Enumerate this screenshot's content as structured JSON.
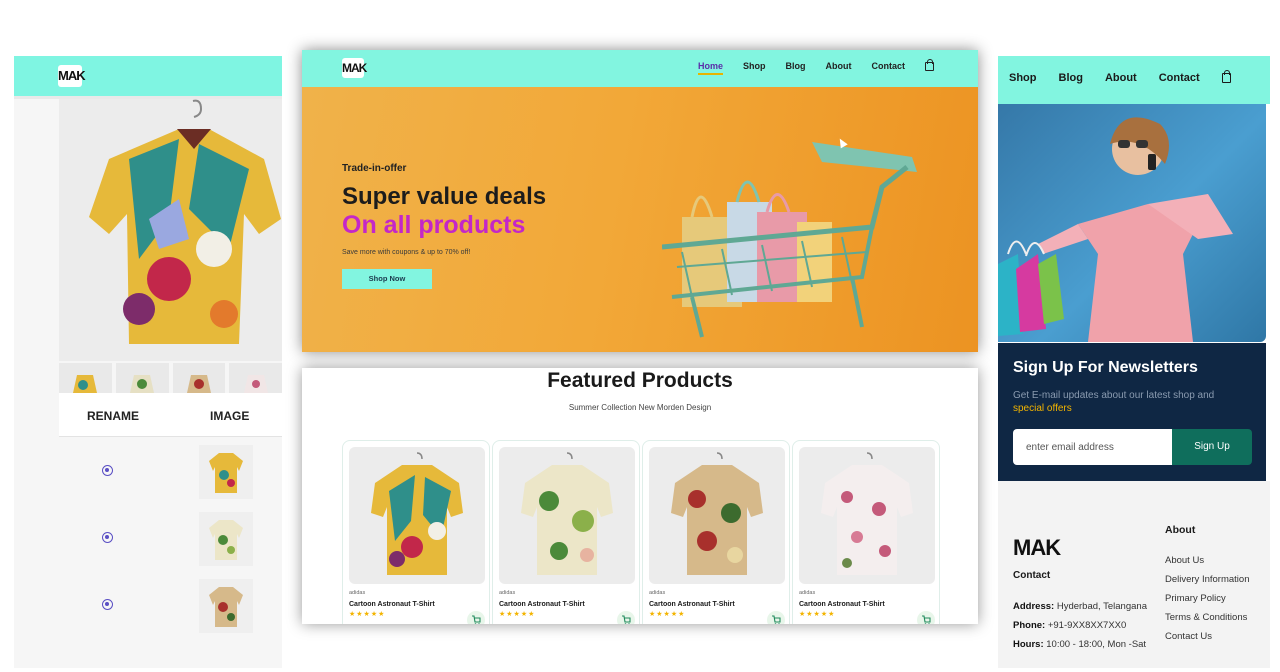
{
  "brand": {
    "logo_text": "MAK"
  },
  "admin_panel": {
    "table_headers": {
      "rename": "RENAME",
      "image": "IMAGE"
    },
    "rows_count": 3
  },
  "hero": {
    "nav": {
      "links": [
        "Home",
        "Shop",
        "Blog",
        "About",
        "Contact"
      ],
      "active": "Home"
    },
    "tagline": "Trade-in-offer",
    "headline": "Super value deals",
    "headline_accent": "On all products",
    "description": "Save more with coupons & up to 70% off!",
    "button": "Shop Now"
  },
  "featured": {
    "title": "Featured Products",
    "subtitle": "Summer Collection New Morden Design",
    "products": [
      {
        "brand": "adidas",
        "name": "Cartoon Astronaut T-Shirt",
        "stars": "★★★★★",
        "rating": 5
      },
      {
        "brand": "adidas",
        "name": "Cartoon Astronaut T-Shirt",
        "stars": "★★★★★",
        "rating": 5
      },
      {
        "brand": "adidas",
        "name": "Cartoon Astronaut T-Shirt",
        "stars": "★★★★★",
        "rating": 5
      },
      {
        "brand": "adidas",
        "name": "Cartoon Astronaut T-Shirt",
        "stars": "★★★★★",
        "rating": 5
      }
    ]
  },
  "right_panel": {
    "nav": {
      "links": [
        "Shop",
        "Blog",
        "About",
        "Contact"
      ]
    },
    "newsletter": {
      "title": "Sign Up For Newsletters",
      "desc": "Get E-mail updates about our latest shop and",
      "desc_highlight": "special offers",
      "placeholder": "enter email address",
      "button": "Sign Up"
    },
    "footer": {
      "contact_title": "Contact",
      "address_label": "Address:",
      "address": "Hyderbad, Telangana",
      "phone_label": "Phone:",
      "phone": "+91-9XX8XX7XX0",
      "hours_label": "Hours:",
      "hours": "10:00 - 18:00, Mon -Sat",
      "about_title": "About",
      "about_links": [
        "About Us",
        "Delivery Information",
        "Primary Policy",
        "Terms & Conditions",
        "Contact Us"
      ]
    }
  },
  "colors": {
    "nav_bg": "#82f5e0",
    "accent_pink": "#c427c8",
    "hero_orange": "#f2a838",
    "newsletter_bg": "#0f2744",
    "signup_btn": "#0f6e5c",
    "star": "#f3b400"
  },
  "icons": [
    "shopping-bag-icon",
    "cart-icon",
    "remove-circle-icon",
    "shirt-image"
  ]
}
